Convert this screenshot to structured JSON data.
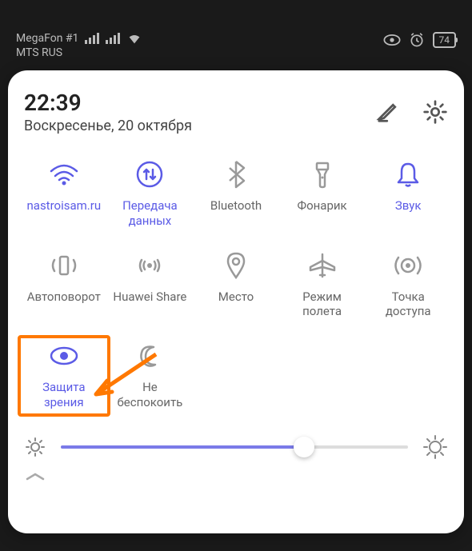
{
  "statusBar": {
    "carrier1": "MegaFon #1",
    "carrier2": "MTS RUS",
    "battery": "74"
  },
  "header": {
    "time": "22:39",
    "date": "Воскресенье, 20 октября"
  },
  "tiles": [
    {
      "label": "nastroisam.ru",
      "icon": "wifi",
      "active": true
    },
    {
      "label": "Передача\nданных",
      "icon": "data",
      "active": true
    },
    {
      "label": "Bluetooth",
      "icon": "bluetooth",
      "active": false
    },
    {
      "label": "Фонарик",
      "icon": "flashlight",
      "active": false
    },
    {
      "label": "Звук",
      "icon": "sound",
      "active": true
    },
    {
      "label": "Автоповорот",
      "icon": "rotate",
      "active": false
    },
    {
      "label": "Huawei Share",
      "icon": "share",
      "active": false
    },
    {
      "label": "Место",
      "icon": "location",
      "active": false
    },
    {
      "label": "Режим\nполета",
      "icon": "airplane",
      "active": false
    },
    {
      "label": "Точка\nдоступа",
      "icon": "hotspot",
      "active": false
    },
    {
      "label": "Защита\nзрения",
      "icon": "eye",
      "active": true,
      "highlighted": true
    },
    {
      "label": "Не\nбеспокоить",
      "icon": "dnd",
      "active": false
    }
  ],
  "brightness": {
    "value": 70
  },
  "colors": {
    "accent": "#5b5be6",
    "inactive": "#888",
    "highlight": "#ff7800"
  }
}
